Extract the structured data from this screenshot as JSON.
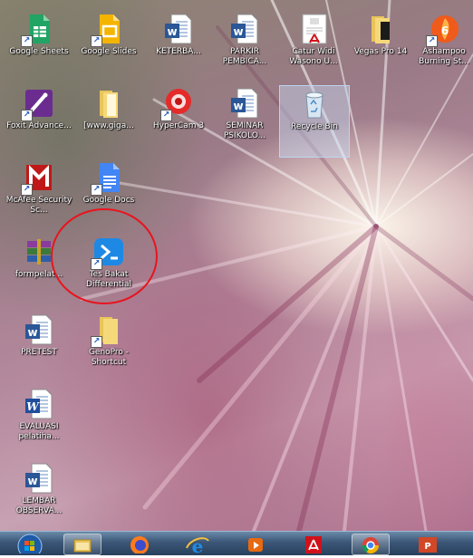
{
  "desktop": {
    "icons": [
      {
        "label": "Google Sheets"
      },
      {
        "label": "Google Slides"
      },
      {
        "label": "KETERBA..."
      },
      {
        "label": "PARKIR PEMBICA..."
      },
      {
        "label": "Catur Widi Wasono U..."
      },
      {
        "label": "Vegas Pro 14"
      },
      {
        "label": "Ashampoo Burning St..."
      },
      {
        "label": "Foxit Advance..."
      },
      {
        "label": "[www.giga..."
      },
      {
        "label": "HyperCam 3"
      },
      {
        "label": "SEMINAR PSIKOLO..."
      },
      {
        "label": "Recycle Bin"
      },
      {
        "label": "McAfee Security Sc..."
      },
      {
        "label": "Google Docs"
      },
      {
        "label": "formpelat..."
      },
      {
        "label": "Tes Bakat Differential"
      },
      {
        "label": "PRETEST"
      },
      {
        "label": "GenoPro - Shortcut"
      },
      {
        "label": "EVALUASI pelatiha..."
      },
      {
        "label": "LEMBAR OBSERVA..."
      }
    ],
    "highlight_color": "#e8141e"
  },
  "taskbar": {
    "start_icon": "windows-orb-icon",
    "items": [
      {
        "icon": "file-explorer-icon"
      },
      {
        "icon": "firefox-icon"
      },
      {
        "icon": "internet-explorer-icon"
      },
      {
        "icon": "media-player-icon"
      },
      {
        "icon": "acrobat-reader-icon"
      },
      {
        "icon": "chrome-icon"
      },
      {
        "icon": "powerpoint-icon"
      }
    ]
  }
}
